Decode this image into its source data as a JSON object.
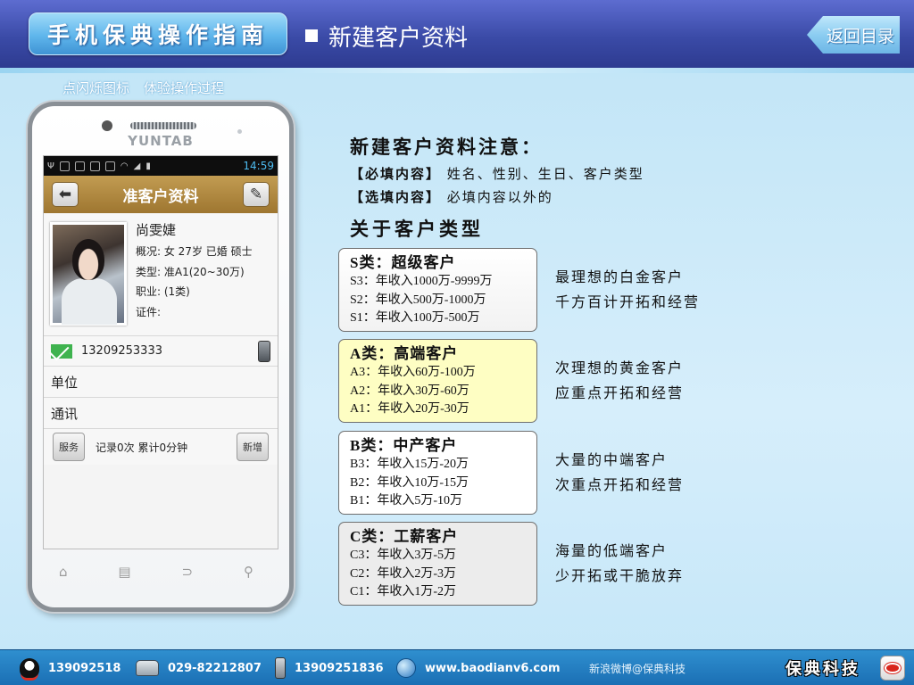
{
  "header": {
    "logo_text": "手机保典操作指南",
    "section_title": "新建客户资料",
    "back_label": "返回目录"
  },
  "hint": {
    "part1": "点闪烁图标",
    "part2": "体验操作过程"
  },
  "phone": {
    "brand": "YUNTAB",
    "status_time": "14:59",
    "screen_title": "准客户资料",
    "customer": {
      "name": "尚雯婕",
      "overview": "概况: 女 27岁 已婚 硕士",
      "type": "类型: 准A1(20~30万)",
      "job": "职业: (1类)",
      "id": "证件:"
    },
    "phone_number": "13209253333",
    "unit_label": "单位",
    "contact_label": "通讯",
    "service_button": "服务",
    "service_record": "记录0次 累计0分钟",
    "add_button": "新增"
  },
  "notes": {
    "title": "新建客户资料注意：",
    "required_tag": "【必填内容】",
    "required_text": "姓名、性别、生日、客户类型",
    "optional_tag": "【选填内容】",
    "optional_text": "必填内容以外的"
  },
  "types_title": "关于客户类型",
  "categories": [
    {
      "title": "S类：超级客户",
      "lines": [
        "S3：年收入1000万-9999万",
        "S2：年收入500万-1000万",
        "S1：年收入100万-500万"
      ],
      "desc": [
        "最理想的白金客户",
        "千方百计开拓和经营"
      ]
    },
    {
      "title": "A类：高端客户",
      "lines": [
        "A3：年收入60万-100万",
        "A2：年收入30万-60万",
        "A1：年收入20万-30万"
      ],
      "desc": [
        "次理想的黄金客户",
        "应重点开拓和经营"
      ]
    },
    {
      "title": "B类：中产客户",
      "lines": [
        "B3：年收入15万-20万",
        "B2：年收入10万-15万",
        "B1：年收入5万-10万"
      ],
      "desc": [
        "大量的中端客户",
        "次重点开拓和经营"
      ]
    },
    {
      "title": "C类：工薪客户",
      "lines": [
        "C3：年收入3万-5万",
        "C2：年收入2万-3万",
        "C1：年收入1万-2万"
      ],
      "desc": [
        "海量的低端客户",
        "少开拓或干脆放弃"
      ]
    }
  ],
  "footer": {
    "qq": "139092518",
    "tel": "029-82212807",
    "mobile": "13909251836",
    "website": "www.baodianv6.com",
    "weibo": "新浪微博@保典科技",
    "brand": "保典科技"
  },
  "colors": {
    "header_blue": "#3a4aa6",
    "footer_blue": "#1b6fb4",
    "title_brown": "#9e7630",
    "category_a_bg": "#fefec3"
  }
}
